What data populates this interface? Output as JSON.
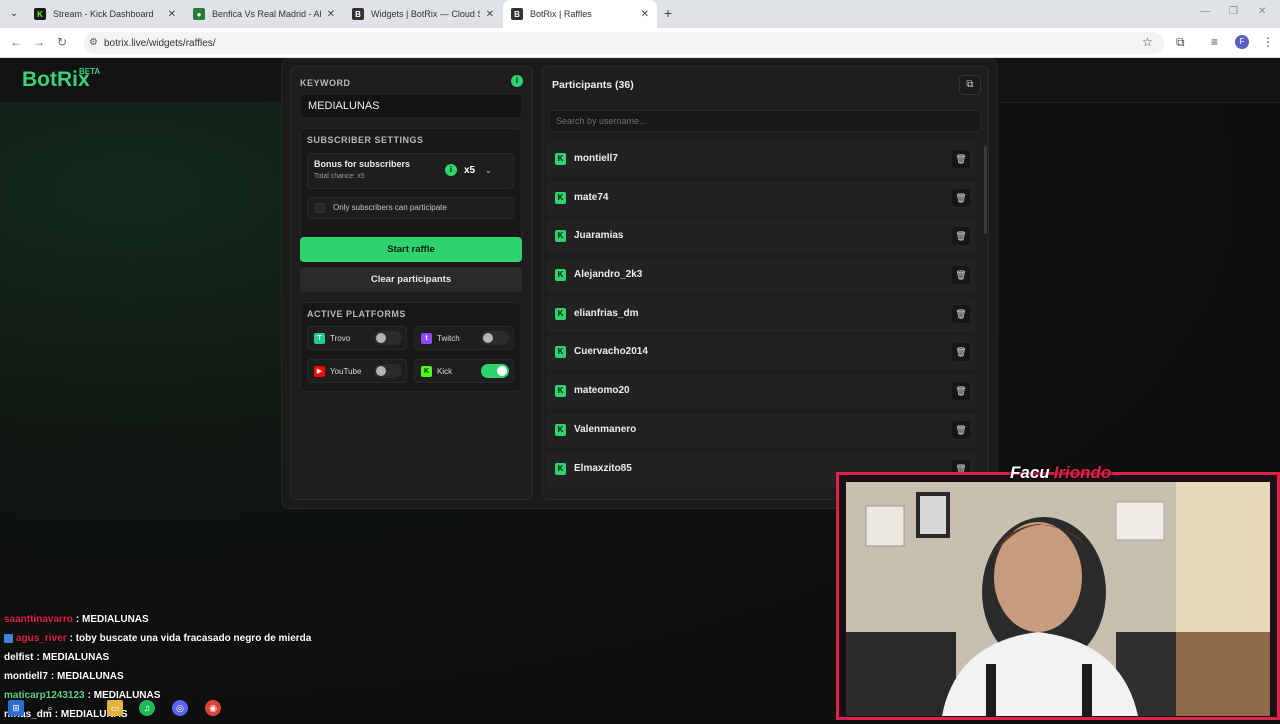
{
  "browser": {
    "tabs": [
      {
        "title": "Stream - Kick Dashboard",
        "active": false
      },
      {
        "title": "Benfica Vs Real Madrid - Alinea",
        "active": false
      },
      {
        "title": "Widgets | BotRix — Cloud Strea",
        "active": false
      },
      {
        "title": "BotRix | Raffles",
        "active": true
      }
    ],
    "url": "botrix.live/widgets/raffles/",
    "profile_initial": "F"
  },
  "app": {
    "logo": "BotRix",
    "beta": "BETA"
  },
  "raffle": {
    "keyword_label": "KEYWORD",
    "keyword_value": "MEDIALUNAS",
    "subscriber_settings_label": "SUBSCRIBER SETTINGS",
    "bonus_title": "Bonus for subscribers",
    "bonus_sub": "Total chance: x5",
    "multiplier": "x5",
    "only_subscribers_label": "Only subscribers can participate",
    "start_button": "Start raffle",
    "clear_button": "Clear participants",
    "active_platforms_label": "ACTIVE PLATFORMS",
    "platforms": [
      {
        "name": "Trovo",
        "enabled": false,
        "color": "#1fcf8e"
      },
      {
        "name": "Twitch",
        "enabled": false,
        "color": "#9146ff"
      },
      {
        "name": "YouTube",
        "enabled": false,
        "color": "#ff0000"
      },
      {
        "name": "Kick",
        "enabled": true,
        "color": "#53fc18"
      }
    ]
  },
  "participants": {
    "title": "Participants (36)",
    "search_placeholder": "Search by username...",
    "list": [
      "montiell7",
      "mate74",
      "Juaramias",
      "Alejandro_2k3",
      "elianfrias_dm",
      "Cuervacho2014",
      "mateomo20",
      "Valenmanero",
      "Elmaxzito85"
    ]
  },
  "chat": [
    {
      "user": "saanttinavarro",
      "user_color": "#e0204a",
      "message": ": MEDIALUNAS"
    },
    {
      "user": "agus_river",
      "user_color": "#e0204a",
      "message": ": toby buscate una vida fracasado negro de mierda"
    },
    {
      "user": "delfist",
      "user_color": "#ffffff",
      "message": ": MEDIALUNAS"
    },
    {
      "user": "montiell7",
      "user_color": "#ffffff",
      "message": ": MEDIALUNAS"
    },
    {
      "user": "maticarp1243123",
      "user_color": "#5ad28a",
      "message": ": MEDIALUNAS"
    },
    {
      "user": "nfrias_dm",
      "user_color": "#ffffff",
      "message": ": MEDIALUNAS"
    }
  ],
  "webcam": {
    "first": "Facu",
    "last": "Iriondo"
  },
  "colors": {
    "accent": "#2fd36d",
    "cam_border": "#e0204a"
  }
}
